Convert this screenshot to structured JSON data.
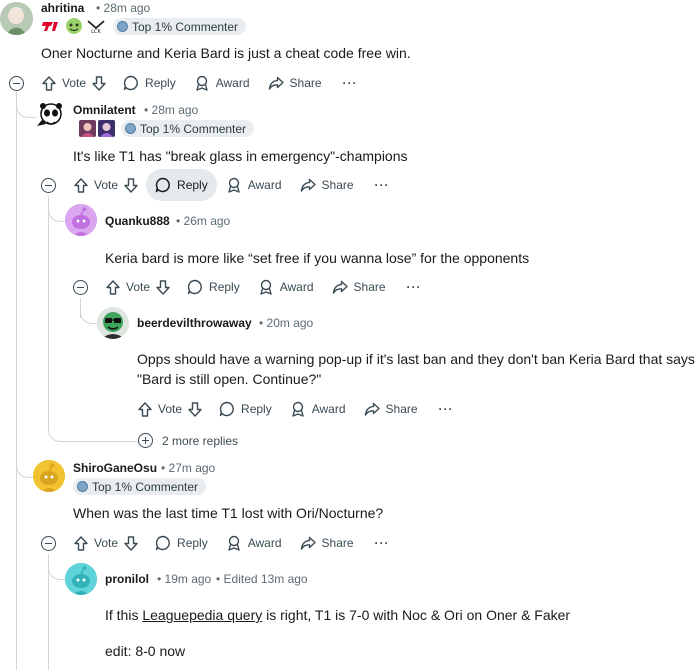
{
  "colors": {
    "text": "#1a1a1b",
    "meta": "#5c6c74",
    "thread_line": "#d0d6d9",
    "active_bg": "#e5e9eb",
    "badge_bg": "#eaedef"
  },
  "actions": {
    "vote": "Vote",
    "reply": "Reply",
    "award": "Award",
    "share": "Share",
    "more": "···"
  },
  "comments": [
    {
      "username": "ahritina",
      "time": "• 28m ago",
      "badge": "Top 1% Commenter",
      "flair_icons": [
        "t1-logo-icon",
        "plant-emote-icon",
        "lck-logo-icon"
      ],
      "body": "Oner Nocturne and Keria Bard is just a cheat code free win."
    },
    {
      "username": "Omnilatent",
      "time": "• 28m ago",
      "badge": "Top 1% Commenter",
      "flair_icons": [
        "champion-portrait-icon",
        "champion-portrait-icon"
      ],
      "body": "It's like T1 has \"break glass in emergency\"-champions"
    },
    {
      "username": "Quanku888",
      "time": "• 26m ago",
      "body": "Keria bard is more like “set free if you wanna lose” for the opponents"
    },
    {
      "username": "beerdevilthrowaway",
      "time": "• 20m ago",
      "body": "Opps should have a warning pop-up if it's last ban and they don't ban Keria Bard that says \"Bard is still open. Continue?\"",
      "more_replies": "2 more replies"
    },
    {
      "username": "ShiroGaneOsu",
      "time": "• 27m ago",
      "badge": "Top 1% Commenter",
      "body": "When was the last time T1 lost with Ori/Nocturne?"
    },
    {
      "username": "pronilol",
      "time": "• 19m ago",
      "edited": "• Edited 13m ago",
      "body_prefix": "If this ",
      "body_link": "Leaguepedia query",
      "body_suffix": " is right, T1 is 7-0 with Noc & Ori on Oner & Faker",
      "body_edit": "edit: 8-0 now"
    }
  ]
}
